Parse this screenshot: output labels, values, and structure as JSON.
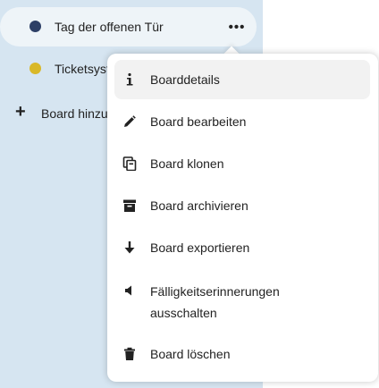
{
  "sidebar": {
    "boards": [
      {
        "label": "Tag der offenen Tür",
        "color": "#2d3f66",
        "active": true
      },
      {
        "label": "Ticketsystem",
        "color": "#d9b828",
        "active": false
      }
    ],
    "add_board_label": "Board hinzufügen",
    "more_actions_label": "•••"
  },
  "menu": {
    "items": [
      {
        "label": "Boarddetails",
        "icon": "info-icon"
      },
      {
        "label": "Board bearbeiten",
        "icon": "pencil-icon"
      },
      {
        "label": "Board klonen",
        "icon": "clone-icon"
      },
      {
        "label": "Board archivieren",
        "icon": "archive-icon"
      },
      {
        "label": "Board exportieren",
        "icon": "arrow-down-icon"
      },
      {
        "label": "Fälligkeitserinnerungen ausschalten",
        "icon": "volume-off-icon"
      },
      {
        "label": "Board löschen",
        "icon": "trash-icon"
      }
    ]
  }
}
